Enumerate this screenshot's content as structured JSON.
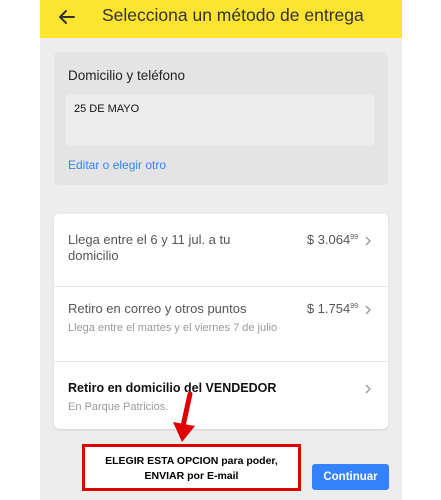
{
  "header": {
    "title": "Selecciona un método de entrega",
    "background": "#fde431"
  },
  "address_card": {
    "title": "Domicilio y teléfono",
    "address": "25 DE MAYO",
    "edit_link": "Editar o elegir otro"
  },
  "shipping_options": [
    {
      "title": "Llega entre el 6 y 11 jul. a tu domicilio",
      "price_main": "$ 3.064",
      "price_cents": "99"
    },
    {
      "title": "Retiro en correo y otros puntos",
      "subtitle": "Llega entre el martes y el viernes 7 de julio",
      "price_main": "$ 1.754",
      "price_cents": "99"
    },
    {
      "title": "Retiro en domicilio del VENDEDOR",
      "subtitle": "En Parque Patricios."
    }
  ],
  "annotation": {
    "line1": "ELEGIR ESTA OPCION para poder,",
    "line2": "ENVIAR por E-mail",
    "color": "#e10000"
  },
  "footer": {
    "continue_label": "Continuar",
    "accent": "#3483fa"
  }
}
